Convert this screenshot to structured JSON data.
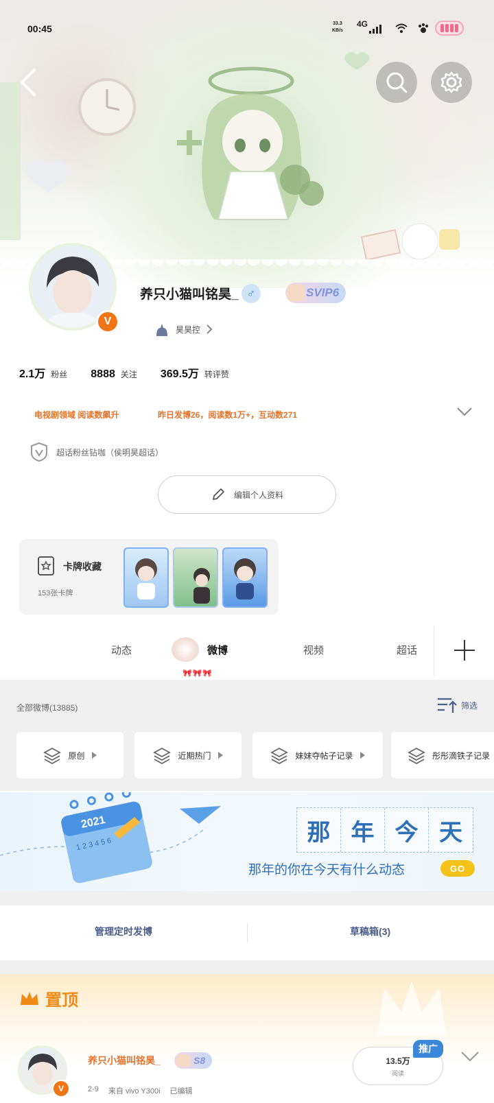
{
  "status_bar": {
    "time": "00:45",
    "speed_value": "33.3",
    "speed_unit": "KB/s",
    "network": "4G"
  },
  "profile": {
    "nickname": "养只小猫叫铭昊_",
    "gender_symbol": "♂",
    "vip_badge": "SVIP6",
    "verified_badge": "V",
    "fan_club": "昊昊控",
    "stats": [
      {
        "value": "2.1万",
        "label": "粉丝"
      },
      {
        "value": "8888",
        "label": "关注"
      },
      {
        "value": "369.5万",
        "label": "转评赞"
      }
    ],
    "honor_1": "电视剧领域  阅读数飙升",
    "honor_2": "昨日发博26，阅读数1万+，互动数271",
    "supertopic": "超话粉丝钻咖（侯明昊超话）",
    "edit_button": "编辑个人资料"
  },
  "cards": {
    "title": "卡牌收藏",
    "count": "153张卡牌"
  },
  "tabs": [
    {
      "label": "动态"
    },
    {
      "label": "微博"
    },
    {
      "label": "视频"
    },
    {
      "label": "超话"
    }
  ],
  "tab_decoration": "🎀🎀🎀",
  "feed": {
    "all_label": "全部微博(13885)",
    "filter_label": "筛选",
    "chips": [
      "原创",
      "近期热门",
      "妹妹夺帖子记录",
      "彤彤滴铁子记录"
    ]
  },
  "memory": {
    "year": "2021",
    "calendar_numbers": "1 2 3 4 5 6",
    "characters": [
      "那",
      "年",
      "今",
      "天"
    ],
    "subtitle": "那年的你在今天有什么动态",
    "go_label": "GO"
  },
  "manage": {
    "scheduled": "管理定时发博",
    "drafts": "草稿箱(3)"
  },
  "pinned": {
    "label": "置顶",
    "author": "养只小猫叫铭昊_",
    "badge": "S8",
    "date": "2-9",
    "source": "来自 vivo Y300i",
    "edited": "已编辑",
    "reads_value": "13.5万",
    "reads_label": "阅读",
    "promo_label": "推广"
  },
  "colors": {
    "accent_orange": "#e8742a",
    "link_blue": "#4a5d8a",
    "verified_orange": "#f07516",
    "memory_blue": "#2f6fb7"
  }
}
